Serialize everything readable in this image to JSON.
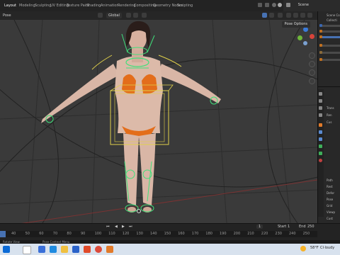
{
  "workspaces": [
    "Layout",
    "Modeling",
    "Sculpting",
    "UV Editing",
    "Texture Paint",
    "Shading",
    "Animation",
    "Rendering",
    "Compositing",
    "Geometry Nodes",
    "Scripting"
  ],
  "scene_name": "Scene",
  "header": {
    "mode": "Pose",
    "orientation": "Global"
  },
  "viewport": {
    "pose_options": "Pose Options"
  },
  "outliner": {
    "title": "Scene Co",
    "rows": [
      "Collecti",
      "",
      "",
      "",
      "",
      ""
    ]
  },
  "properties": {
    "section_rows": [
      "Trans",
      "Ren",
      "Cus",
      "Path",
      "Rest",
      "Defor",
      "Pose",
      "Grid",
      "Viewp",
      "Cust"
    ]
  },
  "timeline": {
    "ticks": [
      "40",
      "50",
      "60",
      "70",
      "80",
      "90",
      "100",
      "110",
      "120",
      "130",
      "140",
      "150",
      "160",
      "170",
      "180",
      "190",
      "200",
      "210",
      "220",
      "230",
      "240",
      "250"
    ],
    "start_label": "Start",
    "start_value": "1",
    "end_label": "End",
    "end_value": "250",
    "current_frame": "1"
  },
  "statusbar": {
    "left": "Rotate View",
    "mid": "Pose Context Menu"
  },
  "taskbar": {
    "temperature": "58°F",
    "weather": "Cl·loudy",
    "clock": ""
  },
  "colors": {
    "accent": "#4772b3",
    "bone_outline": "#e1d14a",
    "selected_bone": "#3fe07a",
    "skin": "#d9b6a6",
    "bikini": "#e36d1b"
  }
}
